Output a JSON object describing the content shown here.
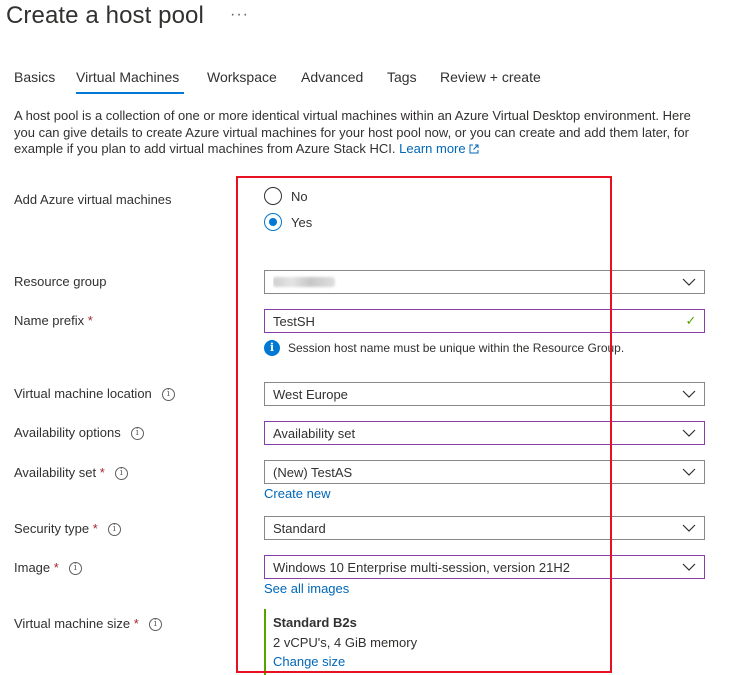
{
  "page": {
    "title": "Create a host pool",
    "more_label": "···"
  },
  "tabs": [
    {
      "label": "Basics"
    },
    {
      "label": "Virtual Machines"
    },
    {
      "label": "Workspace"
    },
    {
      "label": "Advanced"
    },
    {
      "label": "Tags"
    },
    {
      "label": "Review + create"
    }
  ],
  "active_tab": "Virtual Machines",
  "description": {
    "text": "A host pool is a collection of one or more identical virtual machines within an Azure Virtual Desktop environment. Here you can give details to create Azure virtual machines for your host pool now, or you can create and add them later, for example if you plan to add virtual machines from Azure Stack HCI.",
    "learn_more": "Learn more",
    "external_icon": "external-link-icon"
  },
  "form": {
    "add_vms": {
      "label": "Add Azure virtual machines",
      "options": [
        "No",
        "Yes"
      ],
      "selected": "Yes"
    },
    "resource_group": {
      "label": "Resource group",
      "value_redacted": true
    },
    "name_prefix": {
      "label": "Name prefix",
      "required": "*",
      "value": "TestSH",
      "note": "Session host name must be unique within the Resource Group."
    },
    "vm_location": {
      "label": "Virtual machine location",
      "value": "West Europe"
    },
    "availability_options": {
      "label": "Availability options",
      "value": "Availability set"
    },
    "availability_set": {
      "label": "Availability set",
      "required": "*",
      "value": "(New) TestAS",
      "link": "Create new"
    },
    "security_type": {
      "label": "Security type",
      "required": "*",
      "value": "Standard"
    },
    "image": {
      "label": "Image",
      "required": "*",
      "value": "Windows 10 Enterprise multi-session, version 21H2",
      "link": "See all images"
    },
    "vm_size": {
      "label": "Virtual machine size",
      "required": "*",
      "name": "Standard B2s",
      "spec": "2 vCPU's, 4 GiB memory",
      "link": "Change size"
    }
  },
  "colors": {
    "accent": "#0078d4",
    "link": "#0067b8",
    "required": "#a4262c",
    "valid_check": "#57a300",
    "focus_border": "#8a3ea8",
    "annotation_box": "#e81123"
  }
}
